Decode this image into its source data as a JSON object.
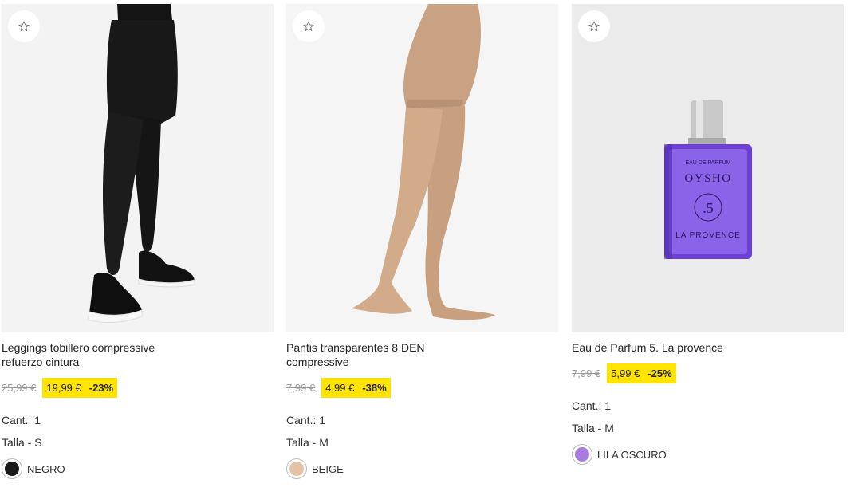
{
  "products": [
    {
      "name": "Leggings tobillero compressive refuerzo cintura",
      "old_price": "25,99 €",
      "price": "19,99 €",
      "discount": "-23%",
      "quantity": "Cant.: 1",
      "size": "Talla - S",
      "color_name": "NEGRO",
      "color_hex": "#1a1a1a",
      "image_icon": "black-leggings-photo"
    },
    {
      "name": "Pantis transparentes 8 DEN compressive",
      "old_price": "7,99 €",
      "price": "4,99 €",
      "discount": "-38%",
      "quantity": "Cant.: 1",
      "size": "Talla - M",
      "color_name": "BEIGE",
      "color_hex": "#e3c2a6",
      "image_icon": "beige-tights-photo"
    },
    {
      "name": "Eau de Parfum 5. La provence",
      "old_price": "7,99 €",
      "price": "5,99 €",
      "discount": "-25%",
      "quantity": "Cant.: 1",
      "size": "Talla - M",
      "color_name": "LILA OSCURO",
      "color_hex": "#a77be0",
      "image_icon": "perfume-bottle-photo",
      "bottle": {
        "line1": "EAU DE PARFUM",
        "brand": "OYSHO",
        "number": ".5",
        "line2": "LA PROVENCE"
      }
    }
  ],
  "colors": {
    "price_highlight": "#ffe400",
    "old_price": "#9b9b9b"
  }
}
